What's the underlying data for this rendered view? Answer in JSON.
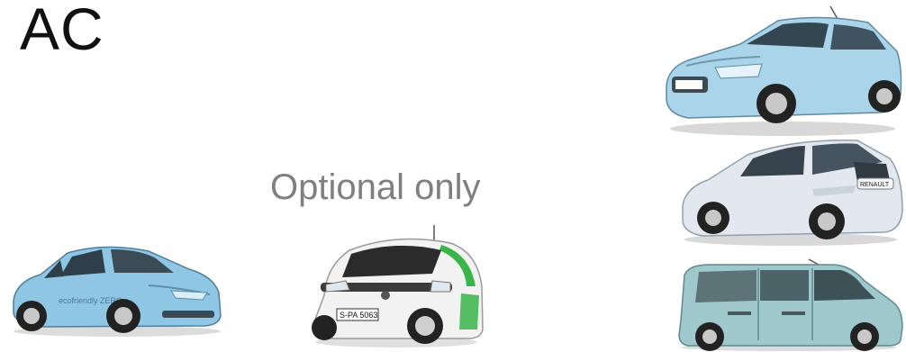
{
  "slide": {
    "title": "AC",
    "subtitle": "Optional only"
  },
  "vehicles": [
    {
      "id": "nissan-leaf",
      "icon": "hatchback-car",
      "color": "#8fc6e4",
      "plate": ""
    },
    {
      "id": "smart-fortwo-ed",
      "icon": "city-car",
      "color": "#f2f2f2",
      "accent": "#39b54a",
      "plate": "S-PA 5063"
    },
    {
      "id": "renault-fluence-ze",
      "icon": "sedan-car",
      "color": "#a9d4ea",
      "plate": ""
    },
    {
      "id": "renault-zoe",
      "icon": "hatchback-car",
      "color": "#e2e8ee",
      "plate": "RENAULT"
    },
    {
      "id": "renault-kangoo-ze",
      "icon": "van",
      "color": "#9ec8cc",
      "plate": ""
    }
  ]
}
